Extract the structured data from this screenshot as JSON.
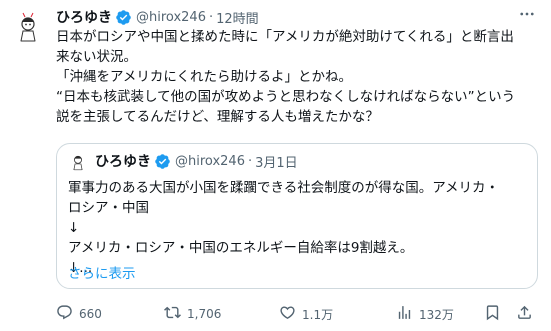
{
  "tweet": {
    "display_name": "ひろゆき",
    "handle": "@hirox246",
    "separator": "·",
    "time": "12時間",
    "text_lines": [
      "日本がロシアや中国と揉めた時に「アメリカが絶対助けてくれる」と断言出",
      "来ない状況。",
      "「沖縄をアメリカにくれたら助けるよ」とかね。",
      "“日本も核武装して他の国が攻めようと思わなくしなければならない”という",
      "説を主張してるんだけど、理解する人も増えたかな？"
    ]
  },
  "quote": {
    "display_name": "ひろゆき",
    "handle": "@hirox246",
    "separator": "·",
    "date": "3月1日",
    "text_lines": [
      "軍事力のある大国が小国を蹂躙できる社会制度のが得な国。アメリカ・",
      "ロシア・中国",
      "↓",
      "アメリカ・ロシア・中国のエネルギー自給率は9割越え。",
      "↓..."
    ],
    "show_more": "さらに表示"
  },
  "actions": {
    "replies": "660",
    "retweets": "1,706",
    "likes": "1.1万",
    "views": "132万"
  },
  "icons": {
    "verified": "verified-badge-icon",
    "more": "more-icon",
    "reply": "reply-icon",
    "retweet": "retweet-icon",
    "like": "heart-icon",
    "views": "views-icon",
    "bookmark": "bookmark-icon",
    "share": "share-icon"
  },
  "colors": {
    "accent": "#1d9bf0",
    "text": "#0f1419",
    "muted": "#536471",
    "border": "#cfd9de"
  }
}
